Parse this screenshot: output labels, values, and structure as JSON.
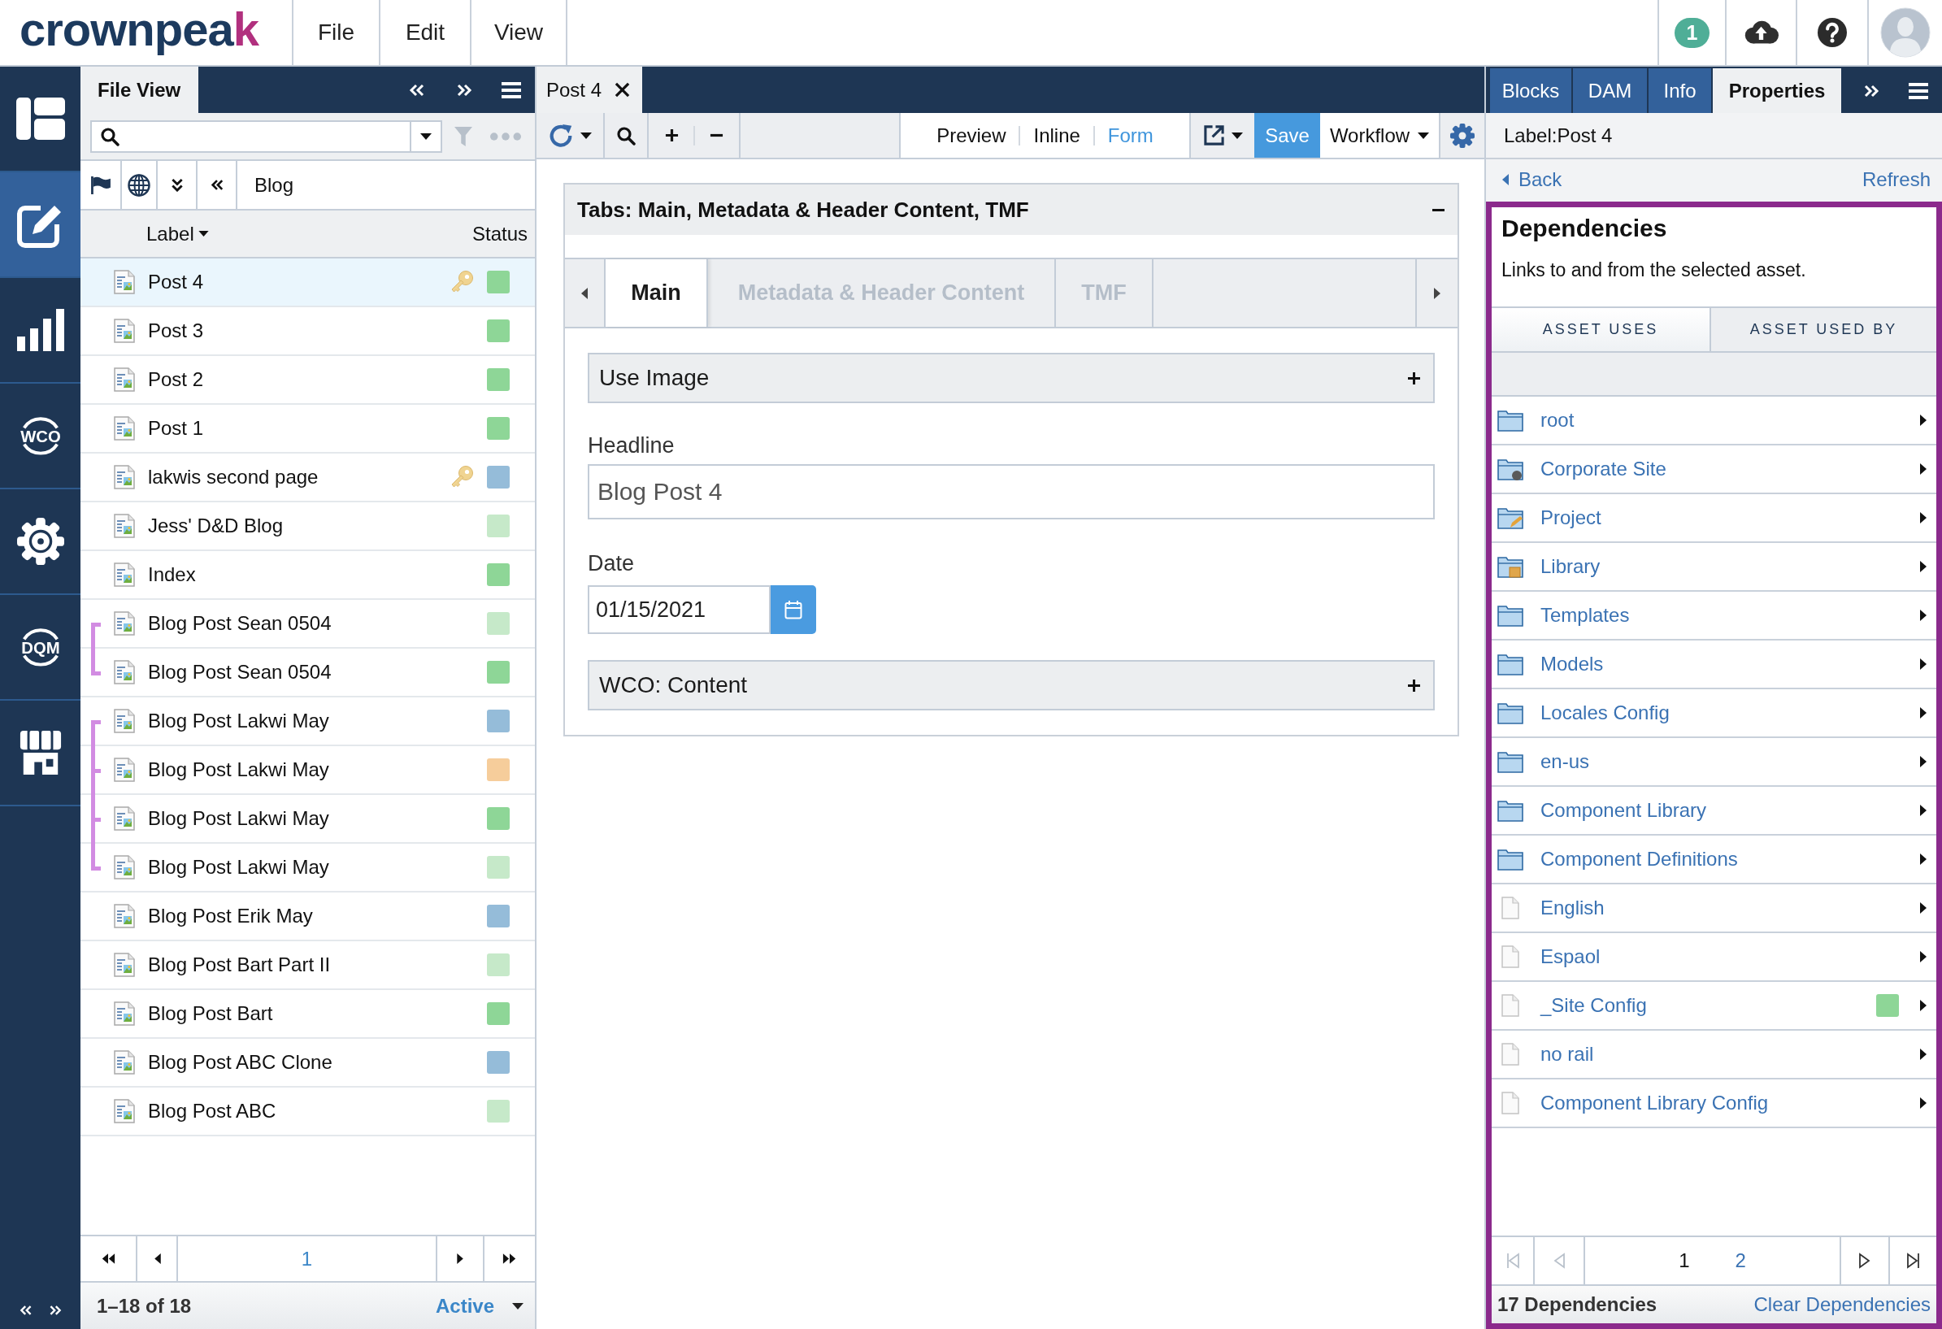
{
  "top_bar": {
    "logo": "crownpeak",
    "menus": [
      "File",
      "Edit",
      "View"
    ],
    "notification_count": "1"
  },
  "rail": {
    "items": [
      {
        "kind": "dashboard",
        "selected": false
      },
      {
        "kind": "edit",
        "selected": true
      },
      {
        "kind": "reports",
        "selected": false
      },
      {
        "kind": "wco",
        "label": "WCO",
        "selected": false
      },
      {
        "kind": "settings",
        "selected": false
      },
      {
        "kind": "dqm",
        "label": "DQM",
        "selected": false
      },
      {
        "kind": "store",
        "selected": false
      }
    ]
  },
  "file_view": {
    "title": "File View",
    "breadcrumb": "Blog",
    "columns": [
      "Label",
      "Status"
    ],
    "rows": [
      {
        "kind": "asset",
        "label": "Post 4",
        "locked": true,
        "color": "#8ed697",
        "selected": true
      },
      {
        "kind": "asset",
        "label": "Post 3",
        "locked": false,
        "color": "#8ed697",
        "selected": false
      },
      {
        "kind": "asset",
        "label": "Post 2",
        "locked": false,
        "color": "#8ed697",
        "selected": false
      },
      {
        "kind": "asset",
        "label": "Post 1",
        "locked": false,
        "color": "#8ed697",
        "selected": false
      },
      {
        "kind": "asset",
        "label": "lakwis second page",
        "locked": true,
        "color": "#95bcd9",
        "selected": false
      },
      {
        "kind": "asset",
        "label": "Jess' D&D Blog",
        "locked": false,
        "color": "#c6e9c9",
        "selected": false
      },
      {
        "kind": "asset",
        "label": "Index",
        "locked": false,
        "color": "#8ed697",
        "selected": false
      },
      {
        "kind": "group",
        "rows": [
          {
            "label": "Blog Post Sean 0504",
            "locked": false,
            "color": "#c6e9c9",
            "selected": false
          },
          {
            "label": "Blog Post Sean 0504",
            "locked": false,
            "color": "#8ed697",
            "selected": false
          }
        ]
      },
      {
        "kind": "group",
        "rows": [
          {
            "label": "Blog Post Lakwi May",
            "locked": false,
            "color": "#95bcd9",
            "selected": false
          },
          {
            "label": "Blog Post Lakwi May",
            "locked": false,
            "color": "#f6cd9b",
            "selected": false
          },
          {
            "label": "Blog Post Lakwi May",
            "locked": false,
            "color": "#8ed697",
            "selected": false
          },
          {
            "label": "Blog Post Lakwi May",
            "locked": false,
            "color": "#c6e9c9",
            "selected": false
          }
        ]
      },
      {
        "kind": "asset",
        "label": "Blog Post Erik May",
        "locked": false,
        "color": "#95bcd9",
        "selected": false
      },
      {
        "kind": "asset",
        "label": "Blog Post Bart Part II",
        "locked": false,
        "color": "#c6e9c9",
        "selected": false
      },
      {
        "kind": "asset",
        "label": "Blog Post Bart",
        "locked": false,
        "color": "#8ed697",
        "selected": false
      },
      {
        "kind": "asset",
        "label": "Blog Post ABC Clone",
        "locked": false,
        "color": "#95bcd9",
        "selected": false
      },
      {
        "kind": "asset",
        "label": "Blog Post ABC",
        "locked": false,
        "color": "#c6e9c9",
        "selected": false
      }
    ],
    "page": "1",
    "count": "1–18 of 18",
    "filter": "Active"
  },
  "editor": {
    "tab": "Post 4",
    "view_modes": [
      {
        "label": "Preview",
        "selected": false
      },
      {
        "label": "Inline",
        "selected": false
      },
      {
        "label": "Form",
        "selected": true
      }
    ],
    "save": "Save",
    "workflow": "Workflow",
    "panel": {
      "title": "Tabs: Main, Metadata & Header Content, TMF",
      "expanded": true,
      "tabs": [
        {
          "label": "Main",
          "selected": true
        },
        {
          "label": "Metadata & Header Content",
          "selected": false
        },
        {
          "label": "TMF",
          "selected": false
        }
      ],
      "fields": [
        {
          "kind": "section",
          "title": "Use Image",
          "expanded": false
        },
        {
          "kind": "text",
          "label": "Headline",
          "value": "Blog Post 4"
        },
        {
          "kind": "date",
          "label": "Date",
          "value": "01/15/2021"
        },
        {
          "kind": "section",
          "title": "WCO: Content",
          "expanded": false
        }
      ]
    }
  },
  "properties": {
    "tabs": [
      {
        "label": "Blocks",
        "selected": false
      },
      {
        "label": "DAM",
        "selected": false
      },
      {
        "label": "Info",
        "selected": false
      },
      {
        "label": "Properties",
        "selected": true
      }
    ],
    "asset_label": "Label:Post 4",
    "back": "Back",
    "refresh": "Refresh",
    "dependencies": {
      "title": "Dependencies",
      "description": "Links to and from the selected asset.",
      "tabs": [
        {
          "label": "ASSET USES",
          "selected": true
        },
        {
          "label": "ASSET USED BY",
          "selected": false
        }
      ],
      "items": [
        {
          "kind": "folder",
          "label": "root"
        },
        {
          "kind": "site",
          "label": "Corporate Site"
        },
        {
          "kind": "project",
          "label": "Project"
        },
        {
          "kind": "library",
          "label": "Library"
        },
        {
          "kind": "folder",
          "label": "Templates"
        },
        {
          "kind": "folder",
          "label": "Models"
        },
        {
          "kind": "folder",
          "label": "Locales Config"
        },
        {
          "kind": "folder",
          "label": "en-us"
        },
        {
          "kind": "folder",
          "label": "Component Library"
        },
        {
          "kind": "folder",
          "label": "Component Definitions"
        },
        {
          "kind": "file",
          "label": "English"
        },
        {
          "kind": "file",
          "label": "Espaol"
        },
        {
          "kind": "file",
          "label": "_Site Config",
          "color": "#8ed697"
        },
        {
          "kind": "file",
          "label": "no rail"
        },
        {
          "kind": "file",
          "label": "Component Library Config"
        }
      ],
      "pager": {
        "back_disabled": true,
        "forward_disabled": false,
        "pages": [
          {
            "label": "1",
            "selected": true
          },
          {
            "label": "2",
            "selected": false
          }
        ]
      },
      "total": "17 Dependencies",
      "clear": "Clear Dependencies"
    }
  }
}
